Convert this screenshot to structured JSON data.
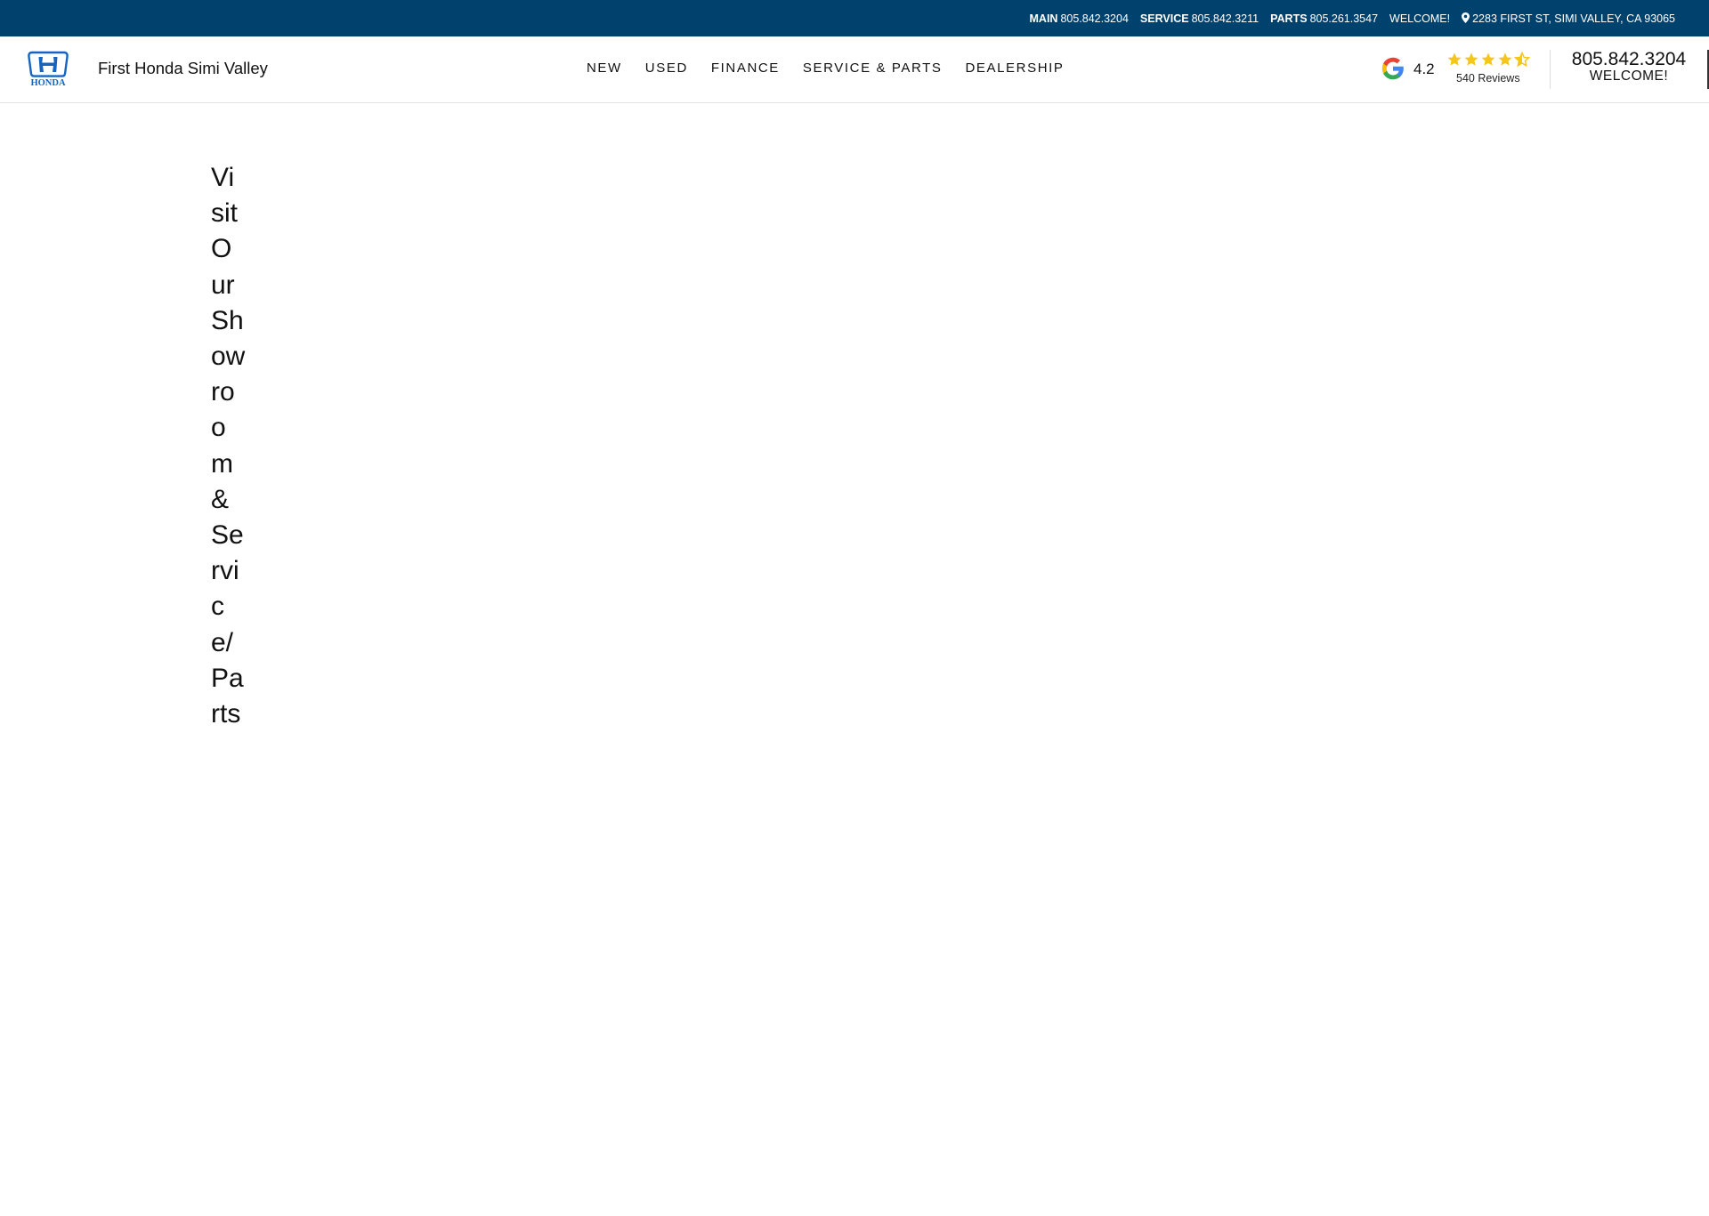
{
  "topbar": {
    "main_label": "MAIN",
    "main_phone": "805.842.3204",
    "service_label": "SERVICE",
    "service_phone": "805.842.3211",
    "parts_label": "PARTS",
    "parts_phone": "805.261.3547",
    "welcome": "WELCOME!",
    "address": "2283 FIRST ST, SIMI VALLEY, CA 93065",
    "address_icon": "map-pin-icon"
  },
  "header": {
    "logo_text": "HONDA",
    "dealer_name": "First Honda Simi Valley",
    "nav": [
      {
        "label": "NEW"
      },
      {
        "label": "USED"
      },
      {
        "label": "FINANCE"
      },
      {
        "label": "SERVICE & PARTS"
      },
      {
        "label": "DEALERSHIP"
      }
    ],
    "rating": {
      "score": "4.2",
      "stars": 4.5,
      "reviews": "540 Reviews",
      "icon": "google-icon"
    },
    "contact": {
      "phone": "805.842.3204",
      "welcome": "WELCOME!"
    }
  },
  "main": {
    "heading": "VisitOurShowroom&Service/Parts"
  },
  "colors": {
    "topbar_bg": "#00426e",
    "honda_blue": "#1565c0",
    "star": "#f5c518"
  }
}
